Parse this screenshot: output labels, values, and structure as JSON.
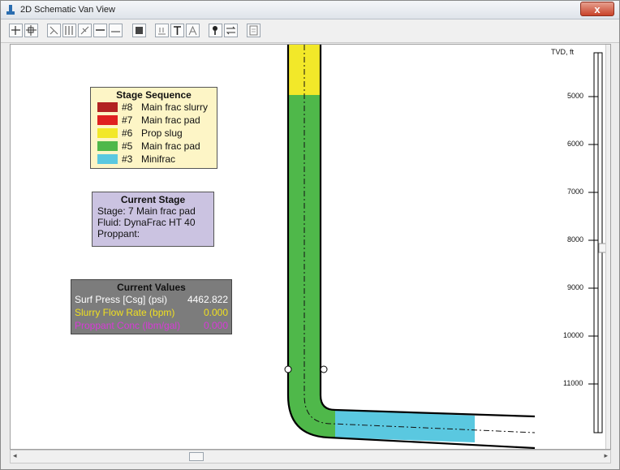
{
  "window": {
    "title": "2D Schematic Van View",
    "close_label": "x"
  },
  "toolbar": {
    "buttons": [
      "pan-tool",
      "zoom-tool",
      "depth-tool",
      "grid-tool",
      "scale-tool",
      "line-tool",
      "dash-tool",
      "record-tool",
      "legend-tool",
      "text-tool",
      "label-tool",
      "marker-tool",
      "flow-tool",
      "print-tool"
    ]
  },
  "legend": {
    "title": "Stage Sequence",
    "items": [
      {
        "num": "#8",
        "name": "Main frac slurry",
        "color": "#b22222"
      },
      {
        "num": "#7",
        "name": "Main frac pad",
        "color": "#e02020"
      },
      {
        "num": "#6",
        "name": "Prop slug",
        "color": "#f2e829"
      },
      {
        "num": "#5",
        "name": "Main frac pad",
        "color": "#4fb84a"
      },
      {
        "num": "#3",
        "name": "Minifrac",
        "color": "#5ac8e0"
      }
    ]
  },
  "current_stage": {
    "title": "Current Stage",
    "stage": "Stage: 7   Main frac pad",
    "fluid": "Fluid: DynaFrac HT 40",
    "proppant": "Proppant:"
  },
  "current_values": {
    "title": "Current Values",
    "rows": [
      {
        "label": "Surf Press [Csg] (psi)",
        "value": "4462.822",
        "color": "#ffffff"
      },
      {
        "label": "Slurry Flow Rate (bpm)",
        "value": "0.000",
        "color": "#f0e020"
      },
      {
        "label": "Proppant Conc (lbm/gal)",
        "value": "0.000",
        "color": "#d83ad8"
      }
    ]
  },
  "depth_axis": {
    "label": "TVD, ft",
    "ticks": [
      "5000",
      "6000",
      "7000",
      "8000",
      "9000",
      "10000",
      "11000"
    ]
  },
  "colors": {
    "prop_slug": "#f2e829",
    "main_frac_pad_5": "#4fb84a",
    "minifrac": "#5ac8e0"
  }
}
